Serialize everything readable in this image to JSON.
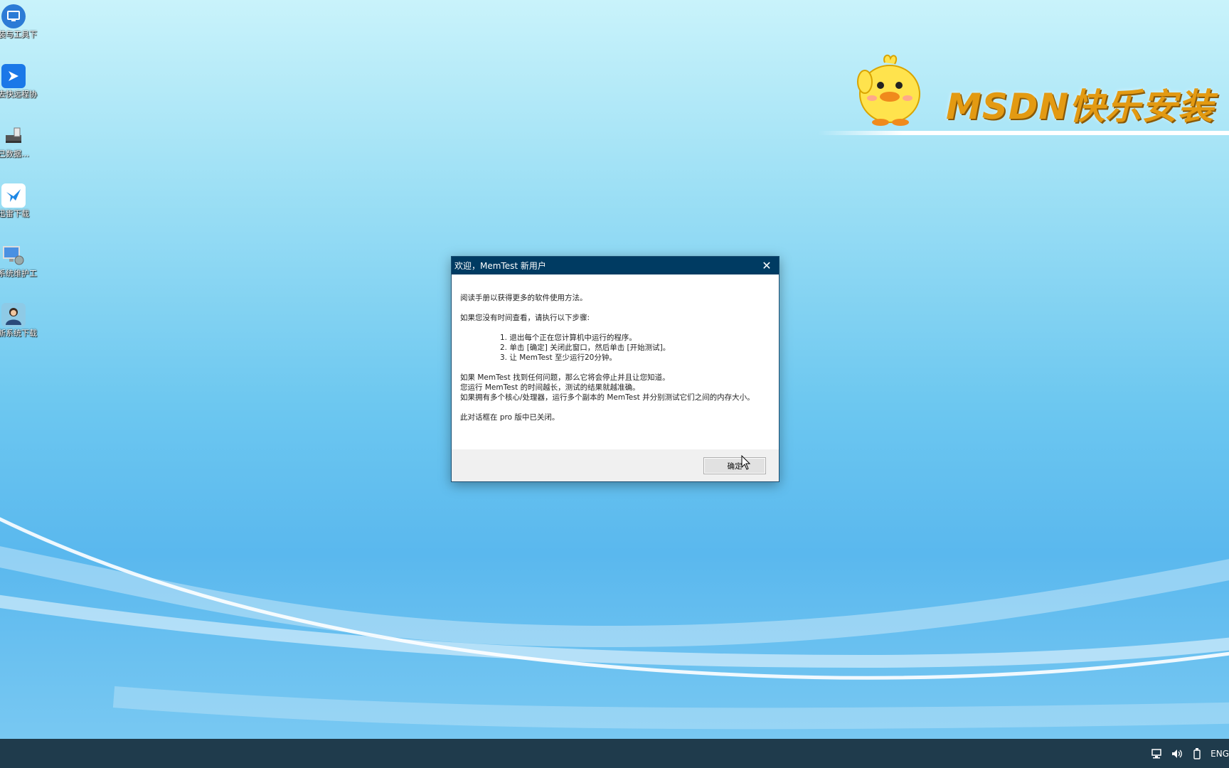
{
  "desktop": {
    "icons": [
      {
        "label": "…装与工具下载",
        "icon": "remote-desktop-icon"
      },
      {
        "label": "…去快远程协助",
        "icon": "remote-assist-icon"
      },
      {
        "label": "…己数据…",
        "icon": "usb-drive-icon"
      },
      {
        "label": "…迅雷下载",
        "icon": "bird-download-icon"
      },
      {
        "label": "…系统维护工具",
        "icon": "system-tools-icon"
      },
      {
        "label": "…新系统下载",
        "icon": "user-photo-icon"
      }
    ],
    "brand": {
      "text": "MSDN快乐安装",
      "mascot": "duck-mascot-icon",
      "color": "#e39a12"
    },
    "background_colors": [
      "#c9f3fb",
      "#6cc7f0",
      "#5ab8ee"
    ]
  },
  "dialog": {
    "title": "欢迎，MemTest 新用户",
    "close_label": "✕",
    "intro": "阅读手册以获得更多的软件使用方法。",
    "steps_intro": "如果您没有时间查看，请执行以下步骤:",
    "steps": [
      "1. 退出每个正在您计算机中运行的程序。",
      "2. 单击 [确定] 关闭此窗口，然后单击 [开始测试]。",
      "3. 让 MemTest 至少运行20分钟。"
    ],
    "notes": [
      "如果 MemTest 找到任何问题，那么它将会停止并且让您知道。",
      "您运行 MemTest 的时间越长，测试的结果就越准确。",
      "如果拥有多个核心/处理器，运行多个副本的 MemTest 并分别测试它们之间的内存大小。"
    ],
    "pro_note": "此对话框在 pro 版中已关闭。",
    "ok_label": "确定",
    "titlebar_color": "#003b62"
  },
  "taskbar": {
    "color": "#1f3b4c",
    "tray": {
      "icons": [
        "network-icon",
        "volume-icon",
        "usb-eject-icon"
      ],
      "language": "ENG"
    }
  }
}
